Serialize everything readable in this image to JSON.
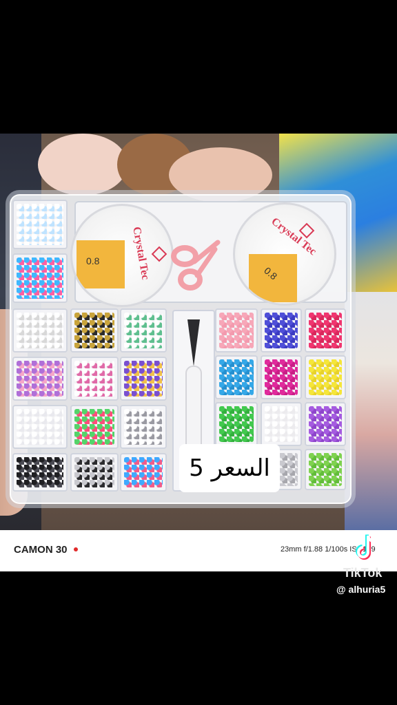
{
  "price_label": "السعر 5",
  "spools": [
    {
      "brand": "Crystal Tec",
      "size": "0.8"
    },
    {
      "brand": "Crystal Tec",
      "size": "0.8"
    }
  ],
  "camera": {
    "model": "CAMON 30",
    "specs": "23mm f/1.88 1/100s ISO139"
  },
  "tiktok": {
    "wordmark": "TikTok",
    "handle": "@ alhuria5"
  },
  "colors": {
    "spool_wedge": "#f2b63d",
    "brand_text": "#d93a55",
    "rec_dot": "#e12b2b"
  }
}
